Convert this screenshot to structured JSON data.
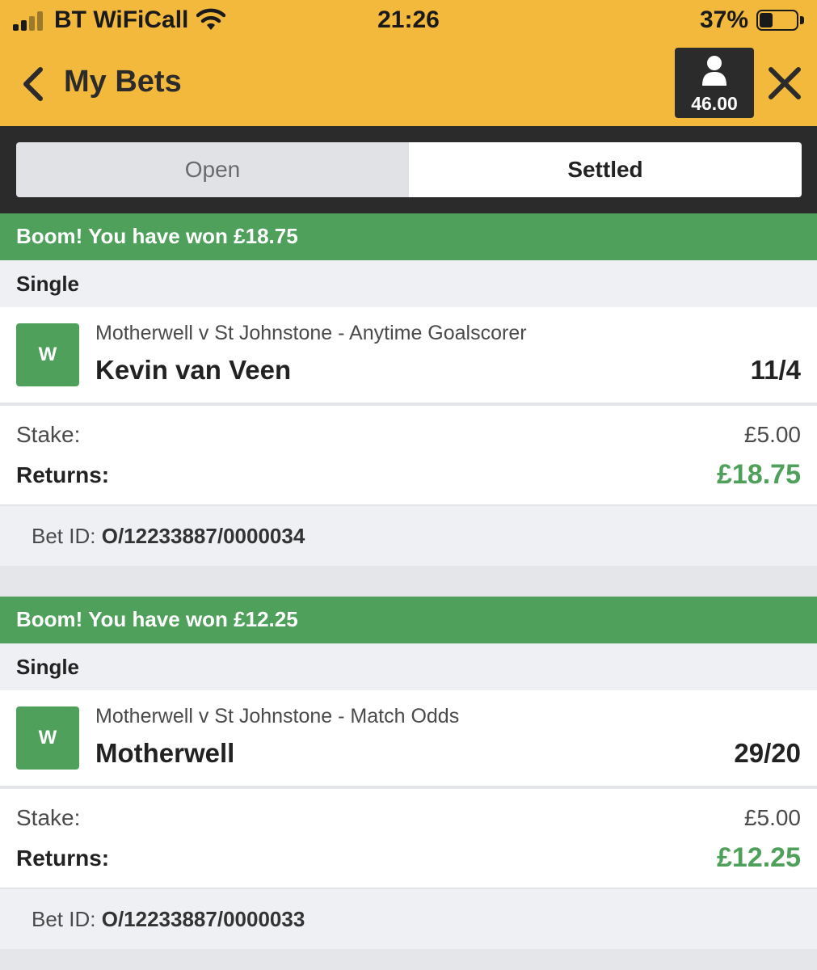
{
  "status_bar": {
    "carrier": "BT WiFiCall",
    "time": "21:26",
    "battery_percent": "37%",
    "battery_level": 0.37
  },
  "header": {
    "title": "My Bets",
    "balance": "46.00",
    "colors": {
      "header_bg": "#f3b93c",
      "dark": "#2b2b2b"
    }
  },
  "tabs": [
    {
      "label": "Open",
      "active": false
    },
    {
      "label": "Settled",
      "active": true
    }
  ],
  "bets": [
    {
      "banner": "Boom! You have won £18.75",
      "type": "Single",
      "result_badge": "W",
      "market": "Motherwell v St Johnstone - Anytime Goalscorer",
      "selection": "Kevin van Veen",
      "odds": "11/4",
      "stake_label": "Stake:",
      "stake": "£5.00",
      "returns_label": "Returns:",
      "returns": "£18.75",
      "bet_id_label": "Bet ID:",
      "bet_id": "O/12233887/0000034"
    },
    {
      "banner": "Boom! You have won £12.25",
      "type": "Single",
      "result_badge": "W",
      "market": "Motherwell v St Johnstone - Match Odds",
      "selection": "Motherwell",
      "odds": "29/20",
      "stake_label": "Stake:",
      "stake": "£5.00",
      "returns_label": "Returns:",
      "returns": "£12.25",
      "bet_id_label": "Bet ID:",
      "bet_id": "O/12233887/0000033"
    }
  ],
  "colors": {
    "win_green": "#4ea05a"
  }
}
